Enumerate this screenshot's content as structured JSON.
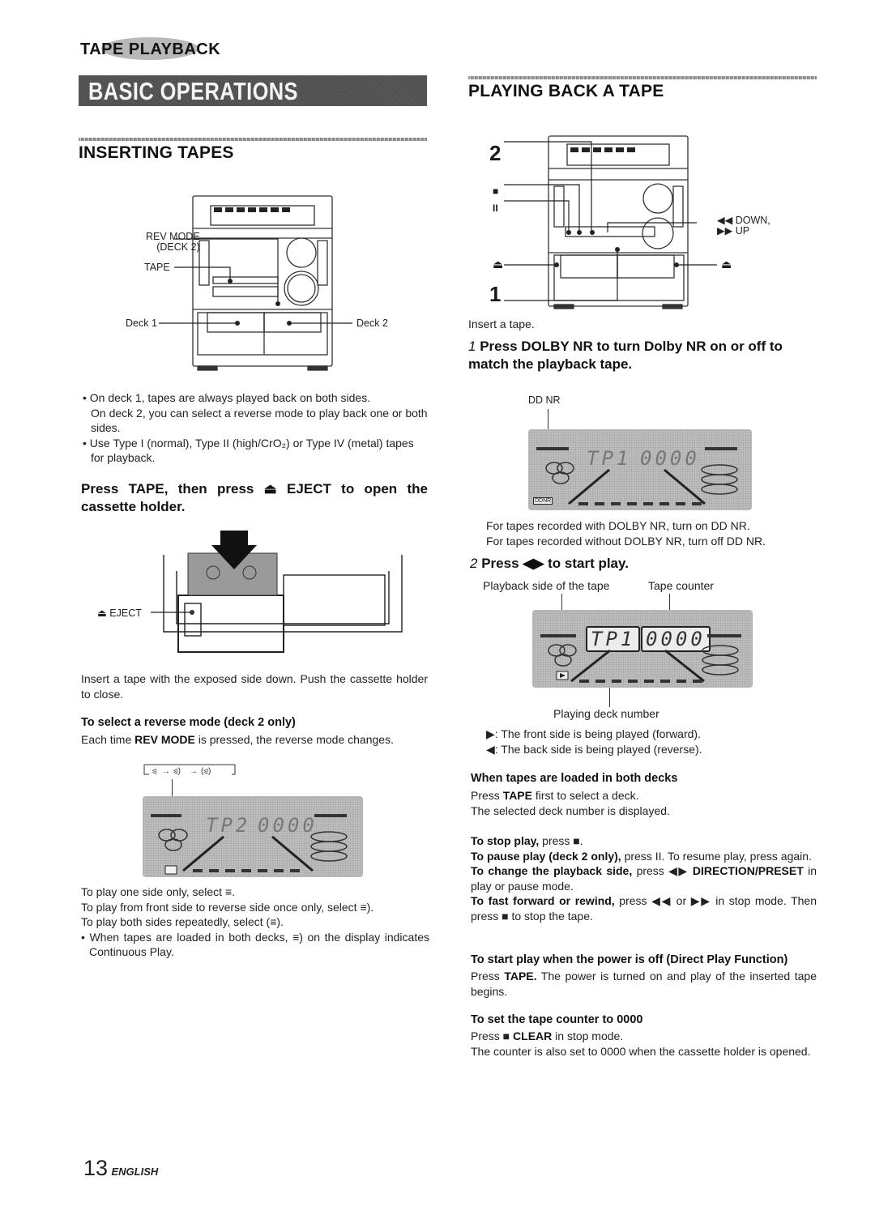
{
  "header": {
    "section_tag": "TAPE PLAYBACK",
    "banner_title": "BASIC OPERATIONS"
  },
  "left": {
    "title": "INSERTING TAPES",
    "diagram1": {
      "labels": {
        "rev_mode_line1": "REV MODE",
        "rev_mode_line2": "(DECK 2)",
        "tape": "TAPE",
        "deck1": "Deck 1",
        "deck2": "Deck 2"
      }
    },
    "bullets": [
      "On deck 1, tapes are always played back on both sides.",
      "Use Type I (normal), Type II (high/CrO₂) or Type IV (metal) tapes for playback."
    ],
    "bullet1_cont": "On deck 2, you can select a reverse mode to play back one or both sides.",
    "instruction": "Press TAPE, then press ⏏ EJECT to open the cassette holder.",
    "eject_label": "⏏ EJECT",
    "insert_note": "Insert a tape with the exposed side down. Push the cassette holder to close.",
    "reverse_mode": {
      "heading": "To select a reverse mode (deck 2 only)",
      "text_pre": "Each time ",
      "text_bold": "REV MODE",
      "text_post": " is pressed, the reverse mode changes.",
      "sequence": [
        "⪨",
        "⪨)",
        "(⪨)"
      ],
      "display": {
        "deck": "TP2",
        "counter": "0000"
      }
    },
    "play_notes": [
      "To play one side only, select ≡.",
      "To play from front side to reverse side once only, select ≡).",
      "To play both sides repeatedly, select (≡)."
    ],
    "continuous_note": "When tapes are loaded in both decks, ≡) on the display indicates Continuous Play."
  },
  "right": {
    "title": "PLAYING BACK A TAPE",
    "diagram2": {
      "labels": {
        "step2": "2",
        "step1": "1",
        "stop": "■",
        "pause": "II",
        "down": "◀◀ DOWN,",
        "up": "▶▶ UP",
        "eject_left": "⏏",
        "eject_right": "⏏"
      }
    },
    "insert_tape": "Insert a tape.",
    "step1": {
      "num": "1",
      "text": "Press DOLBY NR to turn Dolby NR on or off to match the playback tape.",
      "nr_label": "DD NR",
      "display": {
        "deck": "TP1",
        "counter": "0000",
        "nr_badge": "DDNR"
      },
      "notes": [
        "For tapes recorded with DOLBY NR, turn on DD NR.",
        "For tapes recorded without DOLBY NR, turn off DD NR."
      ]
    },
    "step2": {
      "num": "2",
      "text": "Press ◀▶ to start play.",
      "label_side": "Playback side of the tape",
      "label_counter": "Tape counter",
      "label_deck": "Playing deck number",
      "display": {
        "deck": "TP1",
        "counter": "0000"
      },
      "legend": [
        {
          "symbol": "▶:",
          "text": "The front side is being played (forward)."
        },
        {
          "symbol": "◀:",
          "text": "The back side is being played (reverse)."
        }
      ]
    },
    "both_decks": {
      "heading": "When tapes are loaded in both decks",
      "line1_pre": "Press ",
      "line1_bold": "TAPE",
      "line1_post": " first to select a deck.",
      "line2": "The selected deck number is displayed."
    },
    "ops": [
      {
        "bold": "To stop play,",
        "text": " press ■."
      },
      {
        "bold": "To pause play (deck 2 only),",
        "text": " press II. To resume play, press again."
      },
      {
        "bold": "To change the playback side,",
        "text": " press ◀▶ ",
        "bold2": "DIRECTION/PRESET",
        "text2": " in play or pause mode."
      },
      {
        "bold": "To fast forward or rewind,",
        "text": " press ◀◀ or ▶▶ in stop mode. Then press ■ to stop the tape."
      }
    ],
    "direct_play": {
      "heading": "To start play when the power is off (Direct Play Function)",
      "pre": "Press ",
      "bold": "TAPE.",
      "post": " The power is turned on and play of the inserted tape begins."
    },
    "counter_reset": {
      "heading": "To set the tape counter to 0000",
      "line1_pre": "Press ■ ",
      "line1_bold": "CLEAR",
      "line1_post": " in stop mode.",
      "line2": "The counter is also set to 0000 when the cassette holder is opened."
    }
  },
  "footer": {
    "page_number": "13",
    "language": "ENGLISH"
  }
}
